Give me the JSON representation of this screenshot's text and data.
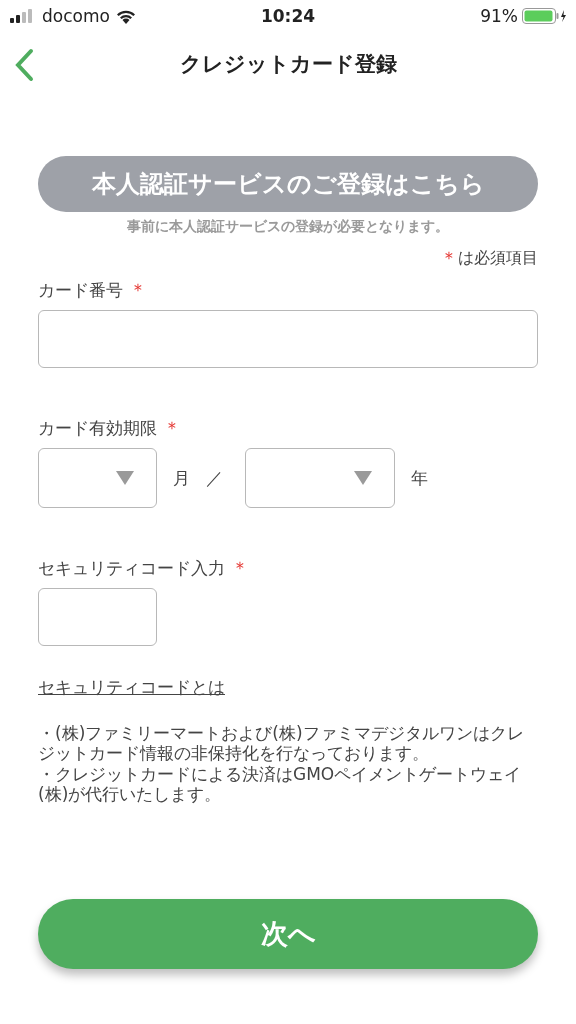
{
  "status_bar": {
    "carrier": "docomo",
    "time": "10:24",
    "battery": "91%"
  },
  "nav": {
    "title": "クレジットカード登録"
  },
  "auth_button": "本人認証サービスのご登録はこちら",
  "auth_note": "事前に本人認証サービスの登録が必要となります。",
  "required_note": {
    "mark": "＊",
    "text": "は必須項目"
  },
  "card_number": {
    "label": "カード番号",
    "required_mark": "＊"
  },
  "expiry": {
    "label": "カード有効期限",
    "required_mark": "＊",
    "month_unit": "月",
    "separator": "／",
    "year_unit": "年"
  },
  "security_code": {
    "label": "セキュリティコード入力",
    "required_mark": "＊"
  },
  "security_link": "セキュリティコードとは",
  "notes": [
    "・(株)ファミリーマートおよび(株)ファミマデジタルワンはクレジットカード情報の非保持化を行なっております。",
    "・クレジットカードによる決済はGMOペイメントゲートウェイ(株)が代行いたします。"
  ],
  "next_button": "次へ"
}
